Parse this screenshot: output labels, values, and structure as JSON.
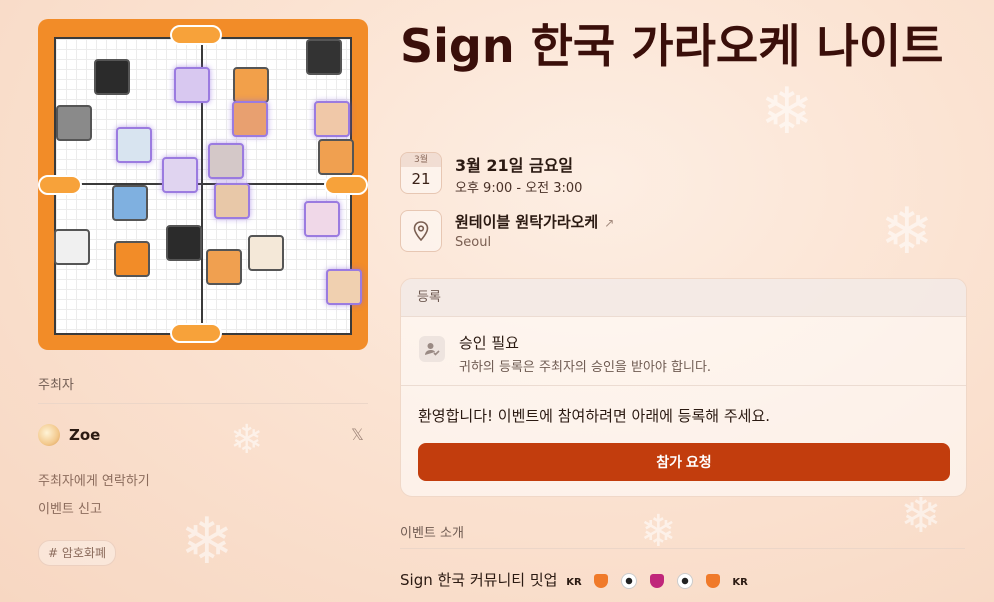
{
  "event": {
    "title": "Sign 한국 가라오케 나이트",
    "date": {
      "month_label": "3월",
      "day": "21",
      "full_date": "3월 21일 금요일",
      "time_range": "오후 9:00 - 오전 3:00"
    },
    "location": {
      "venue": "원테이블 원탁가라오케",
      "arrow": "↗",
      "city": "Seoul"
    }
  },
  "registration": {
    "header": "등록",
    "approval_title": "승인 필요",
    "approval_desc": "귀하의 등록은 주최자의 승인을 받아야 합니다.",
    "welcome": "환영합니다! 이벤트에 참여하려면 아래에 등록해 주세요.",
    "button_label": "참가 요청"
  },
  "about": {
    "heading": "이벤트 소개",
    "text": "Sign 한국 커뮤니티 밋업",
    "kr_tag": "KR"
  },
  "host": {
    "heading": "주최자",
    "name": "Zoe",
    "social_icon_label": "𝕏"
  },
  "links": {
    "contact": "주최자에게 연락하기",
    "report": "이벤트 신고"
  },
  "tag": {
    "hash": "#",
    "label": "암호화폐"
  },
  "colors": {
    "accent": "#c23d0d",
    "title": "#3a0f0a",
    "cover_frame": "#f28c28"
  }
}
